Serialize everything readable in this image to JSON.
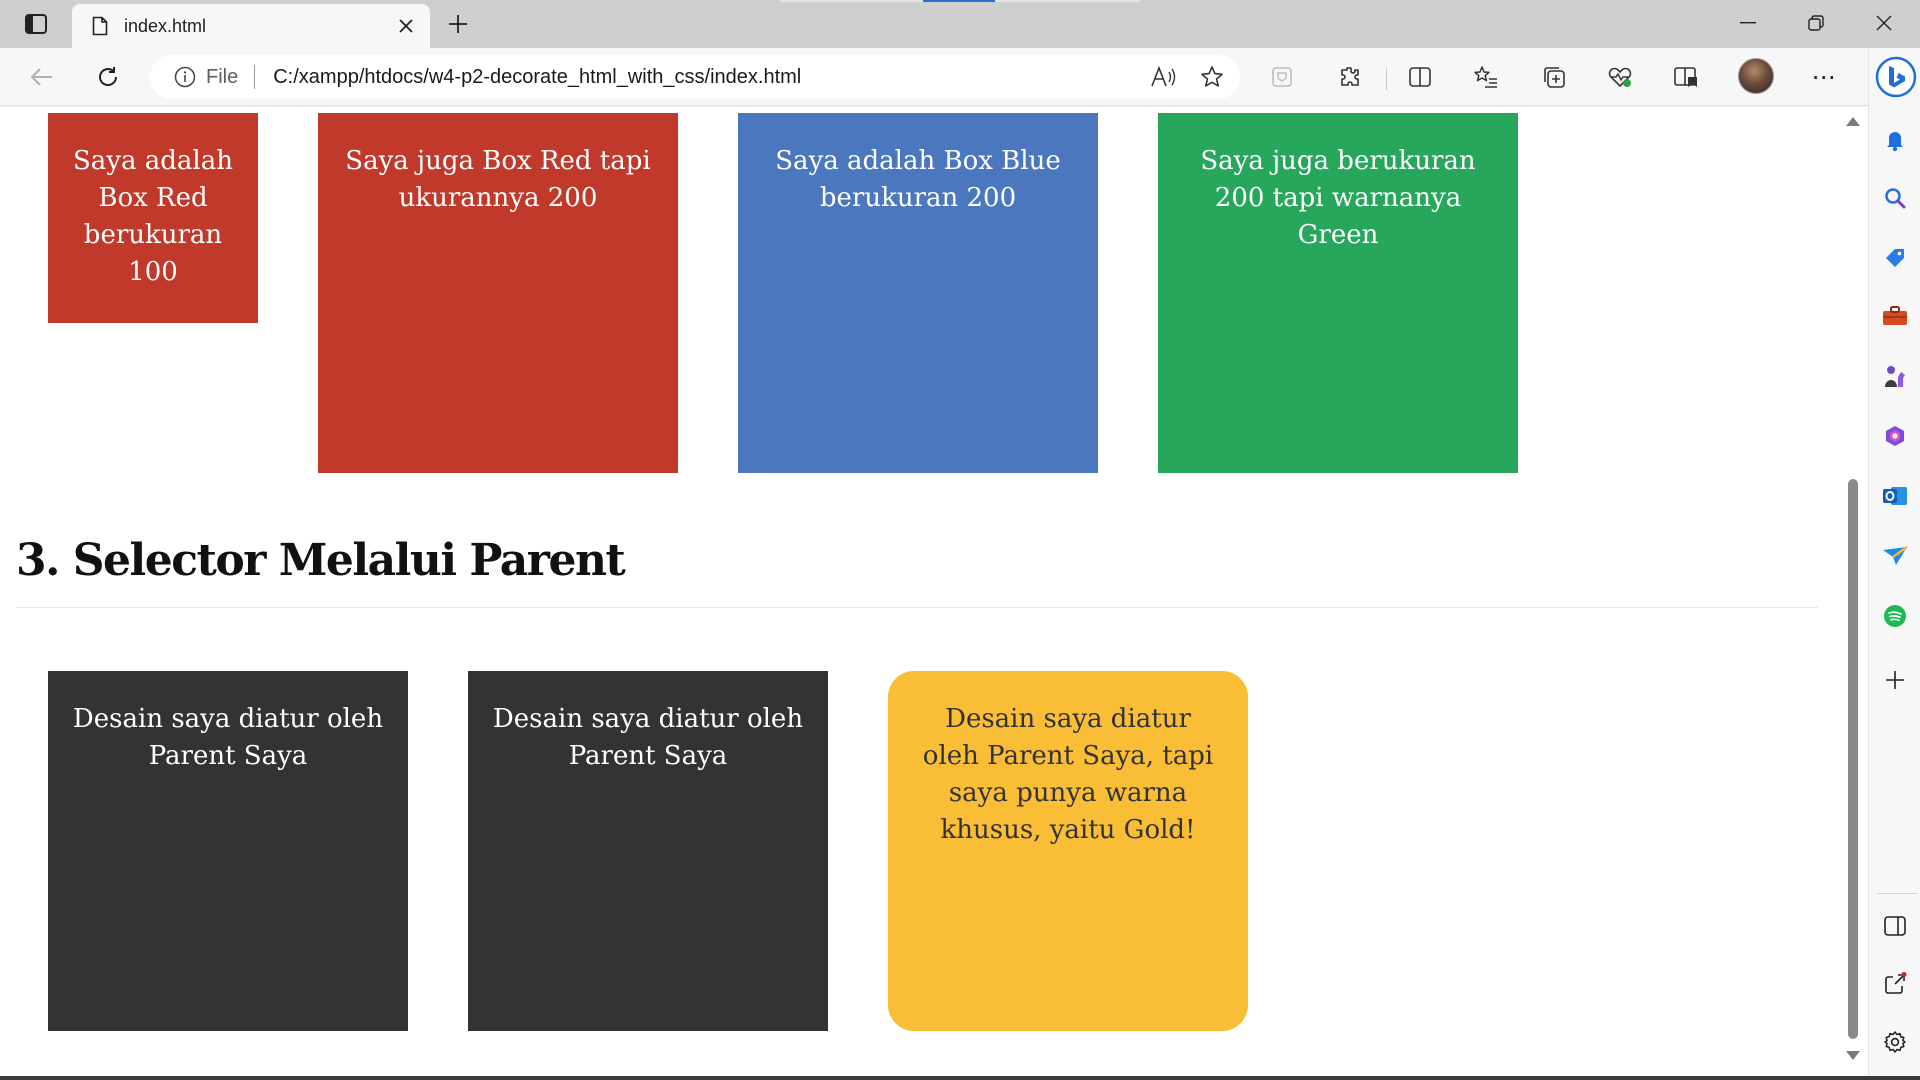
{
  "browser": {
    "tab": {
      "title": "index.html",
      "close_symbol": "✕"
    },
    "new_tab_symbol": "+",
    "address": {
      "site_label": "File",
      "url": "C:/xampp/htdocs/w4-p2-decorate_html_with_css/index.html"
    },
    "more_symbol": "⋯",
    "sidebar_add_symbol": "+"
  },
  "page": {
    "boxes_row1": [
      {
        "text": "Saya adalah Box Red berukuran 100",
        "color": "#c0392b"
      },
      {
        "text": "Saya juga Box Red tapi ukurannya 200",
        "color": "#c0392b"
      },
      {
        "text": "Saya adalah Box Blue berukuran 200",
        "color": "#4a77be"
      },
      {
        "text": "Saya juga berukuran 200 tapi warnanya Green",
        "color": "#27a75c"
      }
    ],
    "section3": {
      "title": "3. Selector Melalui Parent",
      "boxes": [
        {
          "text": "Desain saya diatur oleh Parent Saya",
          "color": "#333333"
        },
        {
          "text": "Desain saya diatur oleh Parent Saya",
          "color": "#333333"
        },
        {
          "text": "Desain saya diatur oleh Parent Saya, tapi saya punya warna khusus, yaitu Gold!",
          "color": "#fabd36"
        }
      ]
    }
  }
}
